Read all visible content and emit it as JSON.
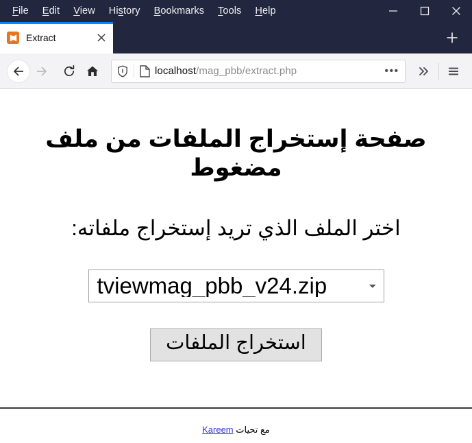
{
  "window": {
    "menu": [
      {
        "label": "File",
        "accel_index": 0,
        "name": "menu-file"
      },
      {
        "label": "Edit",
        "accel_index": 0,
        "name": "menu-edit"
      },
      {
        "label": "View",
        "accel_index": 0,
        "name": "menu-view"
      },
      {
        "label": "History",
        "accel_index": 2,
        "name": "menu-history"
      },
      {
        "label": "Bookmarks",
        "accel_index": 0,
        "name": "menu-bookmarks"
      },
      {
        "label": "Tools",
        "accel_index": 0,
        "name": "menu-tools"
      },
      {
        "label": "Help",
        "accel_index": 0,
        "name": "menu-help"
      }
    ],
    "controls": {
      "minimize": "minimize-icon",
      "maximize": "maximize-icon",
      "close": "close-icon"
    },
    "titlebar_color": "#22263f"
  },
  "tabs": {
    "active": {
      "title": "Extract",
      "favicon": "xampp-favicon-icon",
      "favicon_color": "#e8741f",
      "close_icon": "close-icon",
      "accent_color": "#0a84ff"
    },
    "new_tab_icon": "plus-icon"
  },
  "toolbar": {
    "back_icon": "arrow-left-icon",
    "forward_icon": "arrow-right-icon",
    "reload_icon": "reload-icon",
    "home_icon": "home-icon",
    "shield_icon": "shield-icon",
    "page_icon": "page-document-icon",
    "page_actions_icon": "ellipsis-icon",
    "page_actions_glyph": "•••",
    "overflow_icon": "chevron-double-right-icon",
    "menu_icon": "hamburger-menu-icon",
    "url": {
      "host": "localhost",
      "path": "/mag_pbb/extract.php",
      "full": "localhost/mag_pbb/extract.php"
    }
  },
  "page": {
    "heading": "صفحة إستخراج الملفات من ملف مضغوط",
    "subheading": "اختر الملف الذي تريد إستخراج ملفاته:",
    "file_select": {
      "selected": "tviewmag_pbb_v24.zip",
      "options": [
        "tviewmag_pbb_v24.zip"
      ]
    },
    "extract_button": "استخراج الملفات",
    "footer": {
      "prefix": "مع تحيات ",
      "link": "Kareem",
      "link_color": "#3535d4"
    }
  }
}
